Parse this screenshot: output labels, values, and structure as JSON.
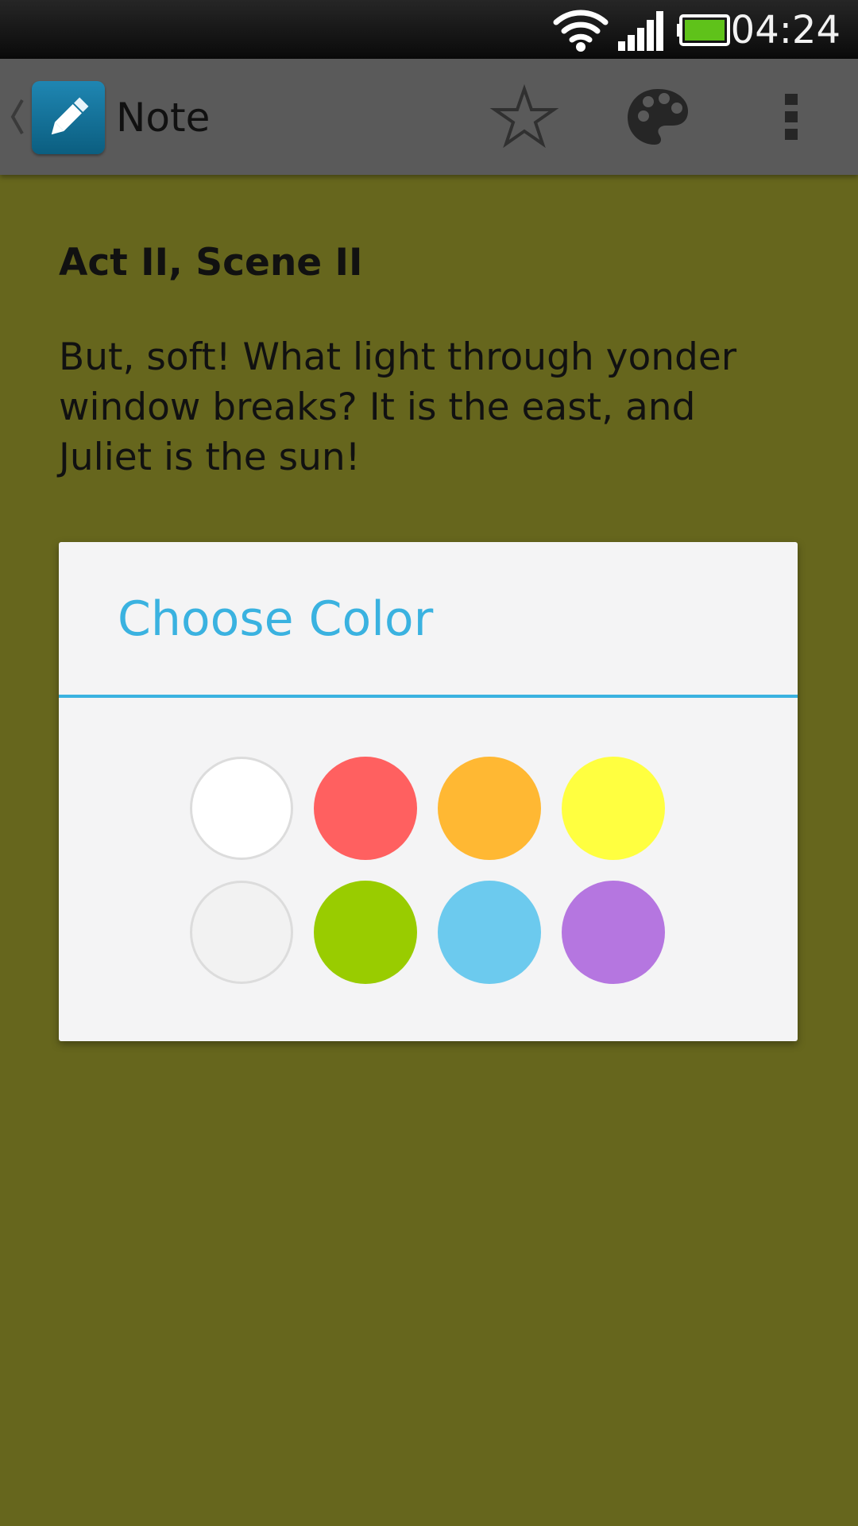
{
  "status_bar": {
    "time": "04:24",
    "icons": [
      "wifi-icon",
      "signal-icon",
      "battery-icon"
    ]
  },
  "action_bar": {
    "title": "Note",
    "app_icon": "pencil-icon",
    "actions": [
      "star-icon",
      "palette-icon",
      "overflow-menu-icon"
    ]
  },
  "note": {
    "heading": "Act II, Scene II",
    "body": "But, soft! What light through yonder window breaks? It is the east, and Juliet is the sun!",
    "background_color": "#66661d"
  },
  "dialog": {
    "title": "Choose Color",
    "accent_color": "#3ab2e0",
    "swatches": [
      {
        "color": "#ffffff"
      },
      {
        "color": "#ff6060"
      },
      {
        "color": "#ffb833"
      },
      {
        "color": "#ffff40"
      },
      {
        "color": "#f2f2f2"
      },
      {
        "color": "#99cc00"
      },
      {
        "color": "#6ccaee"
      },
      {
        "color": "#b576e0"
      }
    ]
  }
}
